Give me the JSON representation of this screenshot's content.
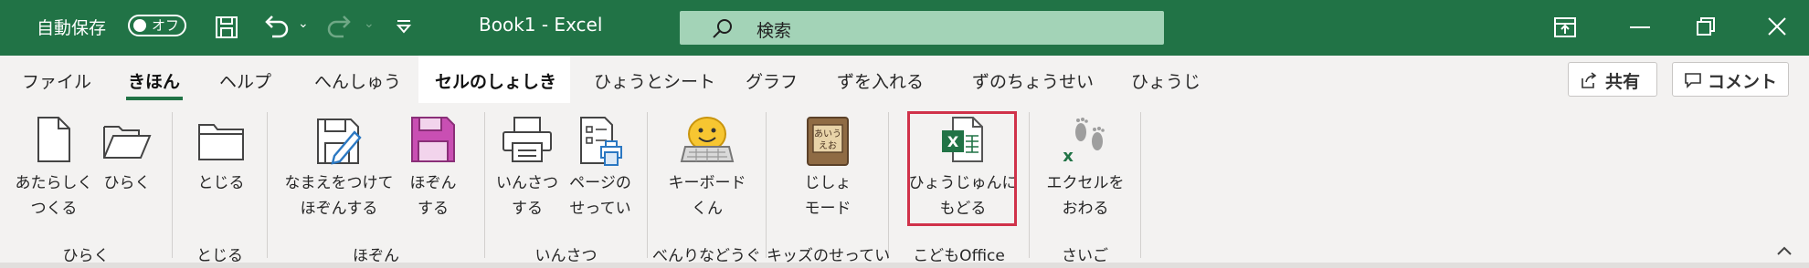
{
  "titlebar": {
    "autosave_label": "自動保存",
    "autosave_state": "オフ",
    "title": "Book1  -  Excel",
    "search_placeholder": "検索",
    "bg_color": "#217346"
  },
  "tabs": [
    {
      "label": "ファイル"
    },
    {
      "label": "きほん"
    },
    {
      "label": "ヘルプ"
    },
    {
      "label": "へんしゅう"
    },
    {
      "label": "セルのしょしき"
    },
    {
      "label": "ひょうとシート"
    },
    {
      "label": "グラフ"
    },
    {
      "label": "ずを入れる"
    },
    {
      "label": "ずのちょうせい"
    },
    {
      "label": "ひょうじ"
    }
  ],
  "share_label": "共有",
  "comment_label": "コメント",
  "ribbon": {
    "buttons": [
      {
        "line1": "あたらしく",
        "line2": "つくる",
        "icon": "new-document-icon"
      },
      {
        "line1": "ひらく",
        "line2": "",
        "icon": "open-folder-icon"
      },
      {
        "line1": "とじる",
        "line2": "",
        "icon": "close-folder-icon"
      },
      {
        "line1": "なまえをつけて",
        "line2": "ほぞんする",
        "icon": "save-as-icon"
      },
      {
        "line1": "ほぞん",
        "line2": "する",
        "icon": "save-icon"
      },
      {
        "line1": "いんさつ",
        "line2": "する",
        "icon": "printer-icon"
      },
      {
        "line1": "ページの",
        "line2": "せってい",
        "icon": "page-setup-icon"
      },
      {
        "line1": "キーボード",
        "line2": "くん",
        "icon": "keyboard-icon"
      },
      {
        "line1": "じしょ",
        "line2": "モード",
        "icon": "dictionary-icon"
      },
      {
        "line1": "ひょうじゅんに",
        "line2": "もどる",
        "icon": "excel-standard-icon"
      },
      {
        "line1": "エクセルを",
        "line2": "おわる",
        "icon": "exit-footprints-icon"
      }
    ],
    "groups": [
      {
        "label": "ひらく"
      },
      {
        "label": "とじる"
      },
      {
        "label": "ほぞん"
      },
      {
        "label": "いんさつ"
      },
      {
        "label": "べんりなどうぐ"
      },
      {
        "label": "キッズのせってい"
      },
      {
        "label": "こどもOffice"
      },
      {
        "label": "さいご"
      }
    ],
    "highlight_color": "#d0324a"
  }
}
